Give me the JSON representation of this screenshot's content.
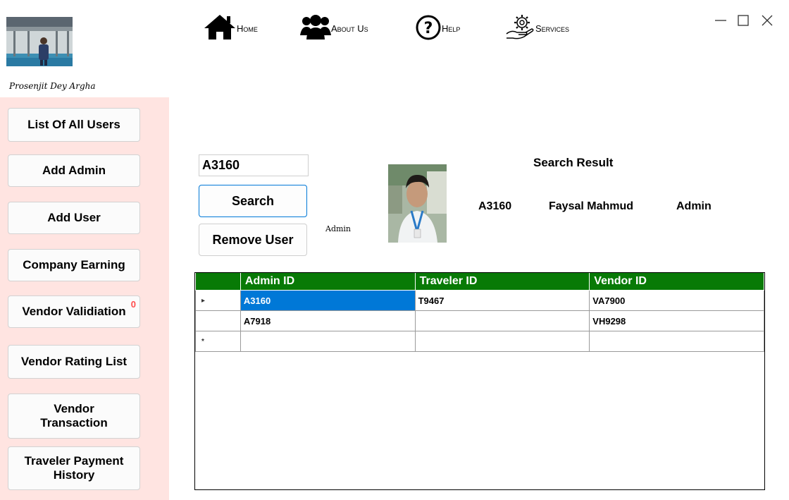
{
  "profile": {
    "name": "Prosenjit Dey Argha"
  },
  "nav": {
    "home": "Home",
    "about": "About Us",
    "help": "Help",
    "services": "Services"
  },
  "sidebar": {
    "items": [
      {
        "label": "List Of All Users"
      },
      {
        "label": "Add Admin"
      },
      {
        "label": "Add User"
      },
      {
        "label": "Company Earning"
      },
      {
        "label": "Vendor Validiation",
        "badge": "0"
      },
      {
        "label": "Vendor Rating List"
      },
      {
        "label": "Vendor Transaction"
      },
      {
        "label": "Traveler Payment History"
      }
    ]
  },
  "search": {
    "value": "A3160",
    "search_label": "Search",
    "remove_label": "Remove User",
    "role_small": "Admin",
    "result_title": "Search Result",
    "result_id": "A3160",
    "result_name": "Faysal Mahmud",
    "result_role": "Admin"
  },
  "grid": {
    "columns": [
      "Admin ID",
      "Traveler ID",
      "Vendor ID"
    ],
    "rows": [
      [
        "A3160",
        "T9467",
        "VA7900"
      ],
      [
        "A7918",
        "",
        "VH9298"
      ],
      [
        "",
        "",
        ""
      ]
    ],
    "row_markers": [
      "▸",
      "",
      "*"
    ]
  },
  "colors": {
    "sidebar_bg": "#ffe4e1",
    "grid_header": "#087a06",
    "selection": "#0078d7",
    "badge": "#ff4d4d"
  }
}
